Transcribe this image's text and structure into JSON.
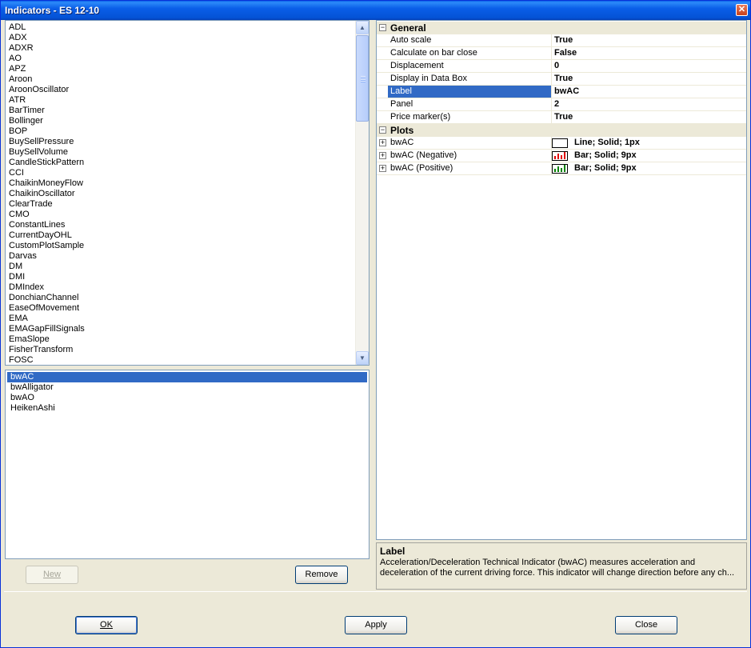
{
  "window": {
    "title": "Indicators - ES 12-10",
    "close_glyph": "✕"
  },
  "available_indicators": [
    "ADL",
    "ADX",
    "ADXR",
    "AO",
    "APZ",
    "Aroon",
    "AroonOscillator",
    "ATR",
    "BarTimer",
    "Bollinger",
    "BOP",
    "BuySellPressure",
    "BuySellVolume",
    "CandleStickPattern",
    "CCI",
    "ChaikinMoneyFlow",
    "ChaikinOscillator",
    "ClearTrade",
    "CMO",
    "ConstantLines",
    "CurrentDayOHL",
    "CustomPlotSample",
    "Darvas",
    "DM",
    "DMI",
    "DMIndex",
    "DonchianChannel",
    "EaseOfMovement",
    "EMA",
    "EMAGapFillSignals",
    "EmaSlope",
    "FisherTransform",
    "FOSC"
  ],
  "applied_indicators": [
    "bwAC",
    "bwAlligator",
    "bwAO",
    "HeikenAshi"
  ],
  "applied_selected": "bwAC",
  "buttons": {
    "new": "New",
    "remove": "Remove",
    "ok": "OK",
    "apply": "Apply",
    "close": "Close"
  },
  "properties": {
    "general_label": "General",
    "general": [
      {
        "name": "Auto scale",
        "value": "True"
      },
      {
        "name": "Calculate on bar close",
        "value": "False"
      },
      {
        "name": "Displacement",
        "value": "0"
      },
      {
        "name": "Display in Data Box",
        "value": "True"
      },
      {
        "name": "Label",
        "value": "bwAC"
      },
      {
        "name": "Panel",
        "value": "2"
      },
      {
        "name": "Price marker(s)",
        "value": "True"
      }
    ],
    "plots_label": "Plots",
    "plots": [
      {
        "name": "bwAC",
        "value": "Line; Solid; 1px",
        "icon": "line-swatch-icon"
      },
      {
        "name": "bwAC (Negative)",
        "value": "Bar; Solid; 9px",
        "icon": "red-bars-icon",
        "color": "#e00000"
      },
      {
        "name": "bwAC (Positive)",
        "value": "Bar; Solid; 9px",
        "icon": "green-bars-icon",
        "color": "#008000"
      }
    ],
    "selected_property": "Label"
  },
  "description": {
    "title": "Label",
    "text": "Acceleration/Deceleration Technical Indicator (bwAC) measures acceleration and deceleration of the current driving force. This indicator will change direction before any ch..."
  }
}
